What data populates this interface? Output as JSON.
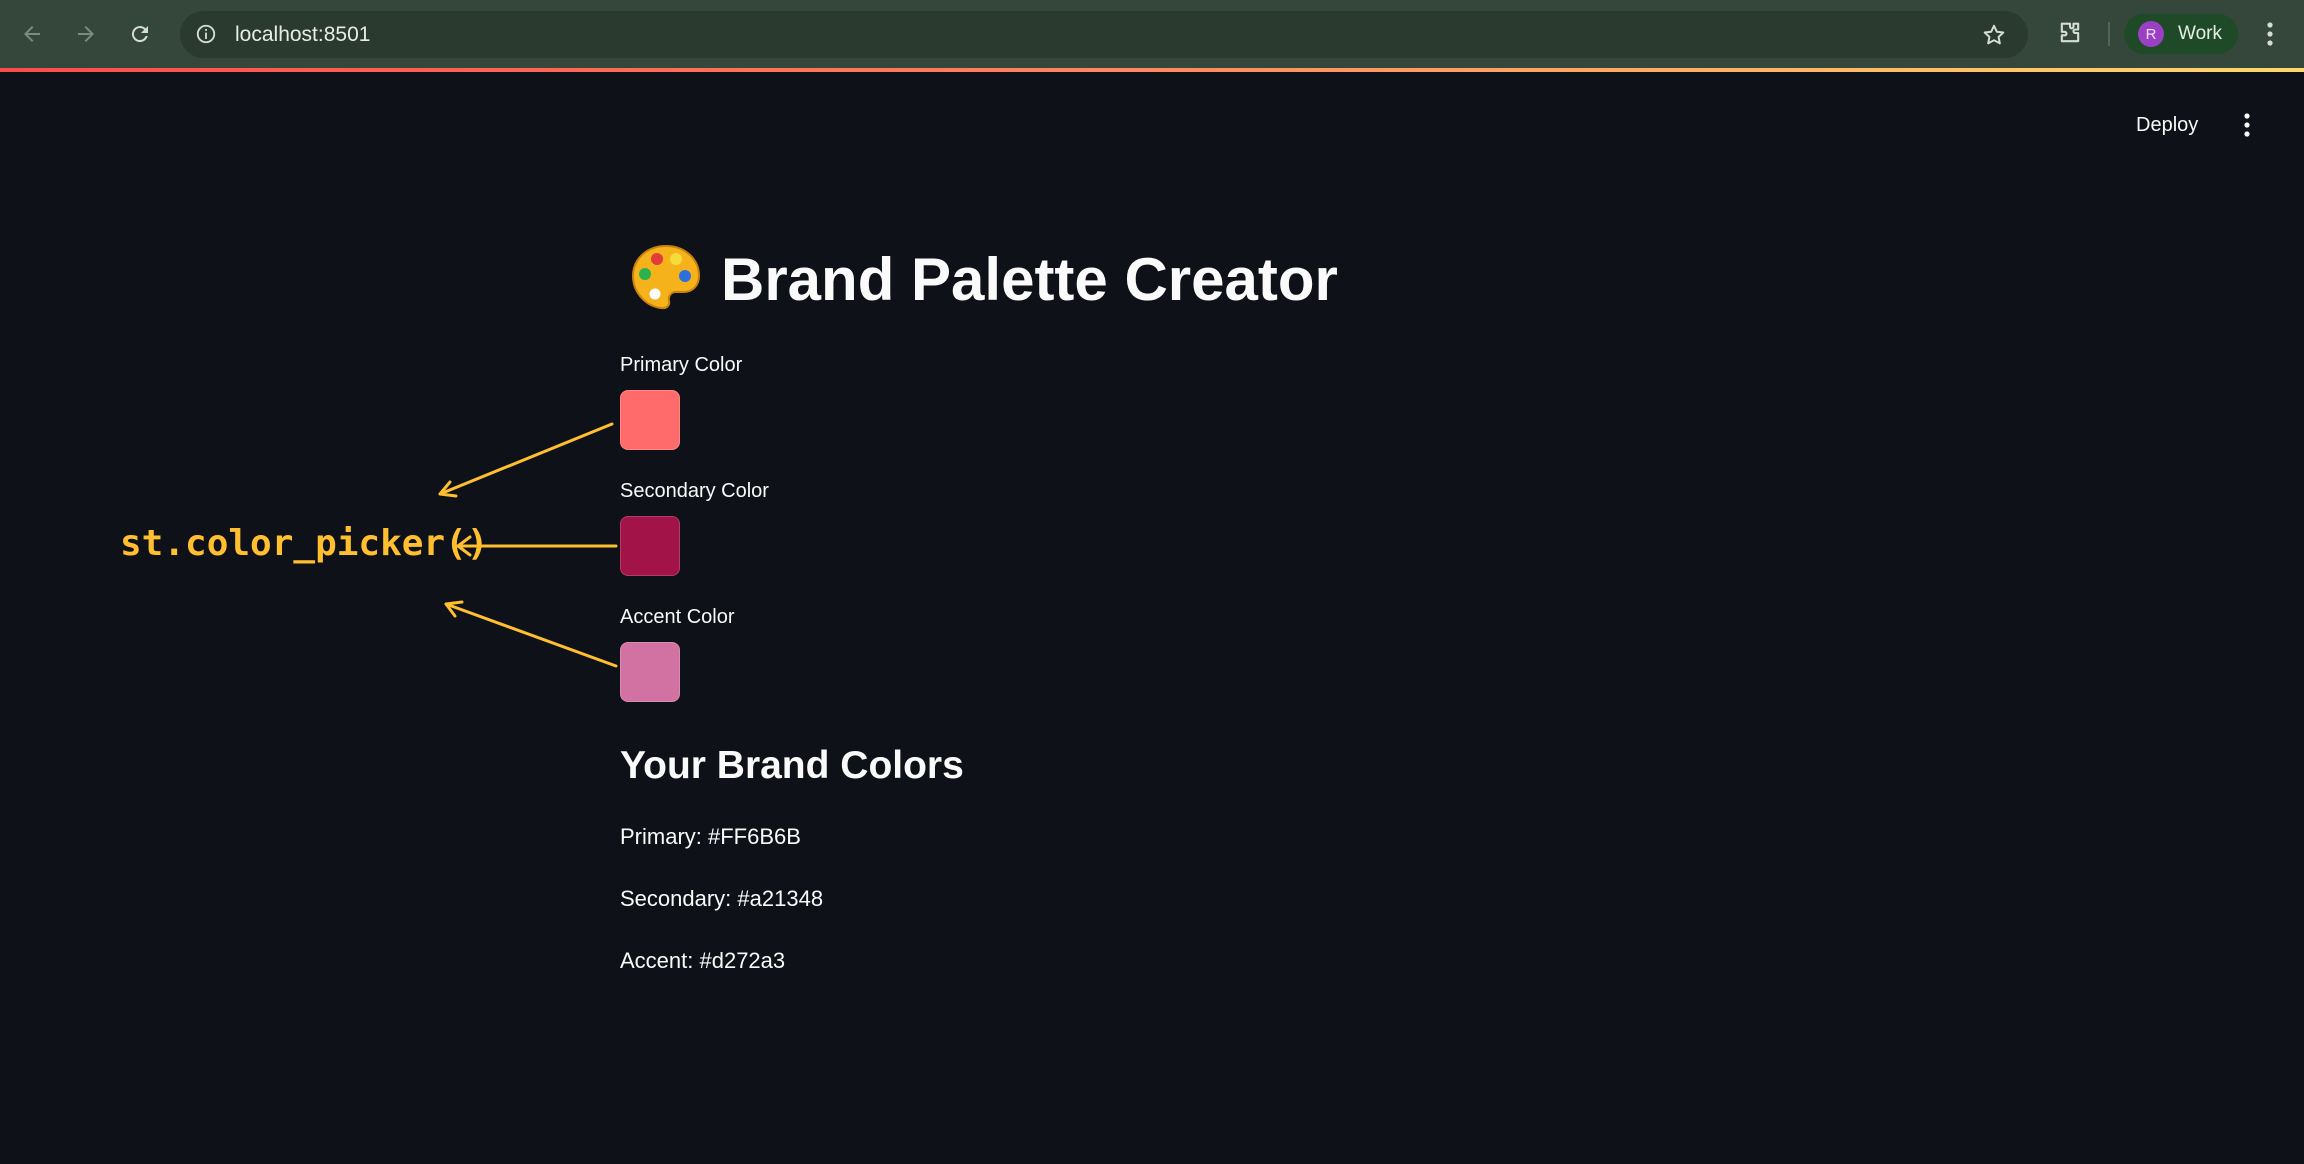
{
  "browser": {
    "url": "localhost:8501",
    "profile_initial": "R",
    "profile_label": "Work",
    "icons": {
      "back": "back-arrow-icon",
      "forward": "forward-arrow-icon",
      "reload": "reload-icon",
      "site_info": "info-icon",
      "bookmark": "star-icon",
      "extensions": "puzzle-icon",
      "menu": "kebab-menu-icon"
    }
  },
  "app_header": {
    "deploy_label": "Deploy",
    "menu_icon": "kebab-menu-icon"
  },
  "main": {
    "title": "Brand Palette Creator",
    "title_icon": "artist-palette-icon",
    "pickers": [
      {
        "label": "Primary Color",
        "value": "#FF6B6B"
      },
      {
        "label": "Secondary Color",
        "value": "#a21348"
      },
      {
        "label": "Accent Color",
        "value": "#d272a3"
      }
    ],
    "subheader": "Your Brand Colors",
    "lines": [
      "Primary: #FF6B6B",
      "Secondary: #a21348",
      "Accent: #d272a3"
    ]
  },
  "annotation": {
    "text": "st.color_picker()",
    "color": "#ffbf2e"
  },
  "theme": {
    "background": "#0e1117",
    "text": "#fafafa",
    "browser_bar": "#35463a"
  }
}
